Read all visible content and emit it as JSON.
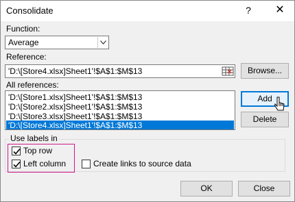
{
  "window": {
    "title": "Consolidate",
    "help": "?",
    "close": "✕"
  },
  "function": {
    "label": "Function:",
    "selected": "Average"
  },
  "reference": {
    "label": "Reference:",
    "value": "'D:\\[Store4.xlsx]Sheet1'!$A$1:$M$13"
  },
  "buttons": {
    "browse": "Browse...",
    "add": "Add",
    "delete": "Delete",
    "ok": "OK",
    "close": "Close"
  },
  "all_references": {
    "label": "All references:",
    "items": [
      "'D:\\[Store1.xlsx]Sheet1'!$A$1:$M$13",
      "'D:\\[Store2.xlsx]Sheet1'!$A$1:$M$13",
      "'D:\\[Store3.xlsx]Sheet1'!$A$1:$M$13",
      "'D:\\[Store4.xlsx]Sheet1'!$A$1:$M$13"
    ]
  },
  "labels_group": {
    "title": "Use labels in",
    "top_row": {
      "label": "Top row",
      "checked": true
    },
    "left_column": {
      "label": "Left column",
      "checked": true
    },
    "create_links": {
      "label": "Create links to source data",
      "checked": false
    }
  },
  "colors": {
    "selection": "#0078d7",
    "highlight_box": "#d0168c",
    "dialog_bg": "#f0f0f0"
  }
}
